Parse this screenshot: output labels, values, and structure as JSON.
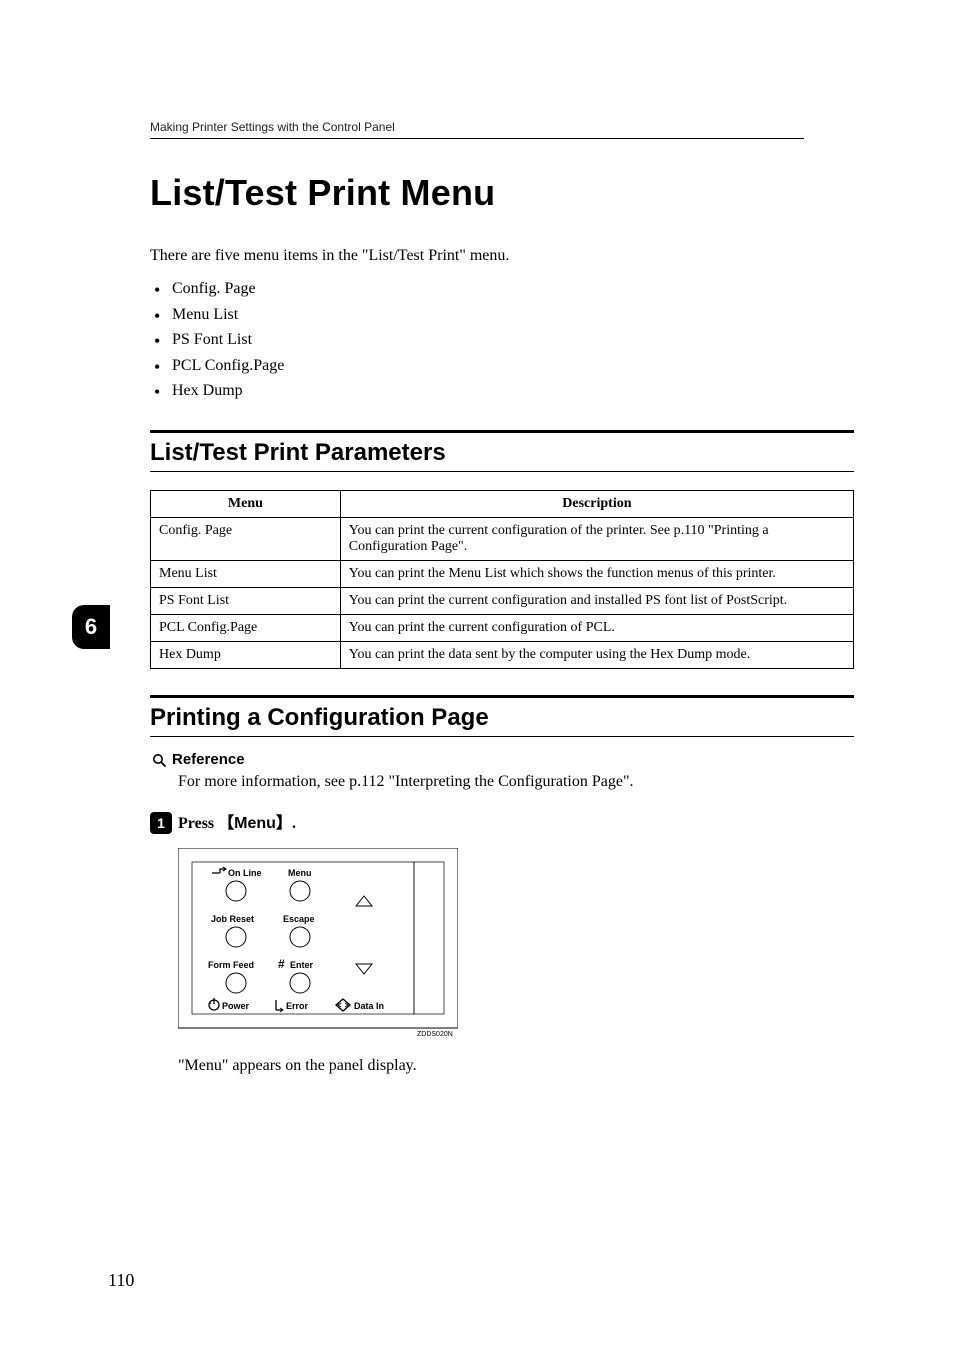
{
  "running_header": "Making Printer Settings with the Control Panel",
  "title": "List/Test Print Menu",
  "intro": "There are five menu items in the \"List/Test Print\" menu.",
  "items": [
    "Config. Page",
    "Menu List",
    "PS Font List",
    "PCL Config.Page",
    "Hex Dump"
  ],
  "section1": "List/Test Print Parameters",
  "table": {
    "head": [
      "Menu",
      "Description"
    ],
    "rows": [
      [
        "Config. Page",
        "You can print the current configuration of the printer. See p.110 \"Printing a Configuration Page\"."
      ],
      [
        "Menu List",
        "You can print the Menu List which shows the function menus of this printer."
      ],
      [
        "PS Font List",
        "You can print the current configuration and installed PS font list of PostScript."
      ],
      [
        "PCL Config.Page",
        "You can print the current configuration of PCL."
      ],
      [
        "Hex Dump",
        "You can print the data sent by the computer using the Hex Dump mode."
      ]
    ]
  },
  "section2": "Printing a Configuration Page",
  "reference_label": "Reference",
  "reference_text": "For more information, see p.112 \"Interpreting the Configuration Page\".",
  "step1_prefix": "Press ",
  "step1_key": "Menu",
  "step1_suffix": ".",
  "panel": {
    "on_line": "On Line",
    "menu": "Menu",
    "job_reset": "Job Reset",
    "escape": "Escape",
    "form_feed": "Form Feed",
    "enter": "Enter",
    "power": "Power",
    "error": "Error",
    "data_in": "Data In",
    "code": "ZDDS020N"
  },
  "caption_after": "\"Menu\" appears on the panel display.",
  "sidebar_number": "6",
  "page_number": "110"
}
